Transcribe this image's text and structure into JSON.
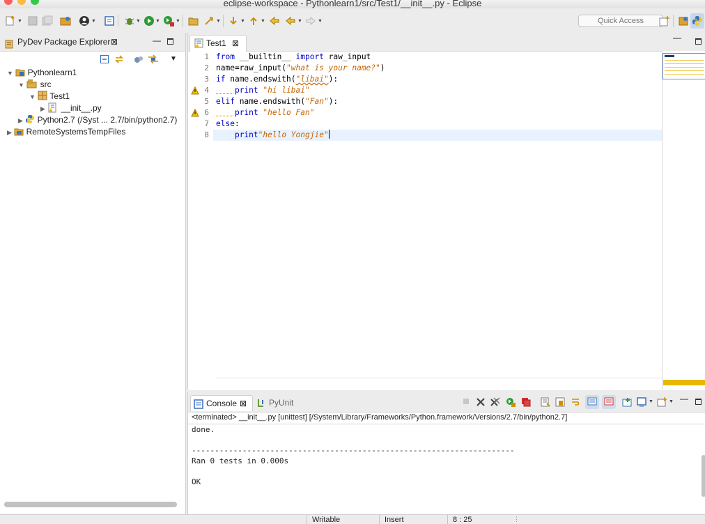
{
  "window": {
    "title": "eclipse-workspace - Pythonlearn1/src/Test1/__init__.py - Eclipse"
  },
  "toolbar": {
    "quick_access_placeholder": "Quick Access"
  },
  "explorer": {
    "title": "PyDev Package Explorer",
    "tree": [
      {
        "label": "Pythonlearn1"
      },
      {
        "label": "src"
      },
      {
        "label": "Test1"
      },
      {
        "label": "__init__.py"
      },
      {
        "label": "Python2.7  (/Syst ... 2.7/bin/python2.7)"
      },
      {
        "label": "RemoteSystemsTempFiles"
      }
    ]
  },
  "editor": {
    "tab_label": "Test1",
    "line_numbers": [
      "1",
      "2",
      "3",
      "4",
      "5",
      "6",
      "7",
      "8"
    ],
    "code": {
      "l1_from": "from",
      "l1_mod": " __builtin__ ",
      "l1_import": "import",
      "l1_name": " raw_input",
      "l2_pre": "name=raw_input(",
      "l2_str": "\"what is your name?\"",
      "l2_post": ")",
      "l3_if": "if",
      "l3_mid": " name.endswith(",
      "l3_str": "\"libai\"",
      "l3_post": "):",
      "l4_indent": "    ",
      "l4_print": "print",
      "l4_str": " \"hi libai\"",
      "l5_elif": "elif",
      "l5_mid": " name.endswith(",
      "l5_str": "\"Fan\"",
      "l5_post": "):",
      "l6_indent": "    ",
      "l6_print": "print",
      "l6_str": " \"hello Fan\"",
      "l7_else": "else",
      "l7_post": ":",
      "l8_indent": "    ",
      "l8_print": "print",
      "l8_str": "\"hello Yongjie\""
    }
  },
  "console": {
    "tab_console": "Console",
    "tab_pyunit": "PyUnit",
    "header": "<terminated> __init__.py [unittest] [/System/Library/Frameworks/Python.framework/Versions/2.7/bin/python2.7]",
    "output": [
      "done.",
      "",
      "----------------------------------------------------------------------",
      "Ran 0 tests in 0.000s",
      "",
      "OK"
    ]
  },
  "status": {
    "writable": "Writable",
    "insert": "Insert",
    "position": "8 : 25"
  },
  "colors": {
    "accent_yellow": "#e8b800",
    "keyword_blue": "#0000c8",
    "string_orange": "#c86400"
  }
}
